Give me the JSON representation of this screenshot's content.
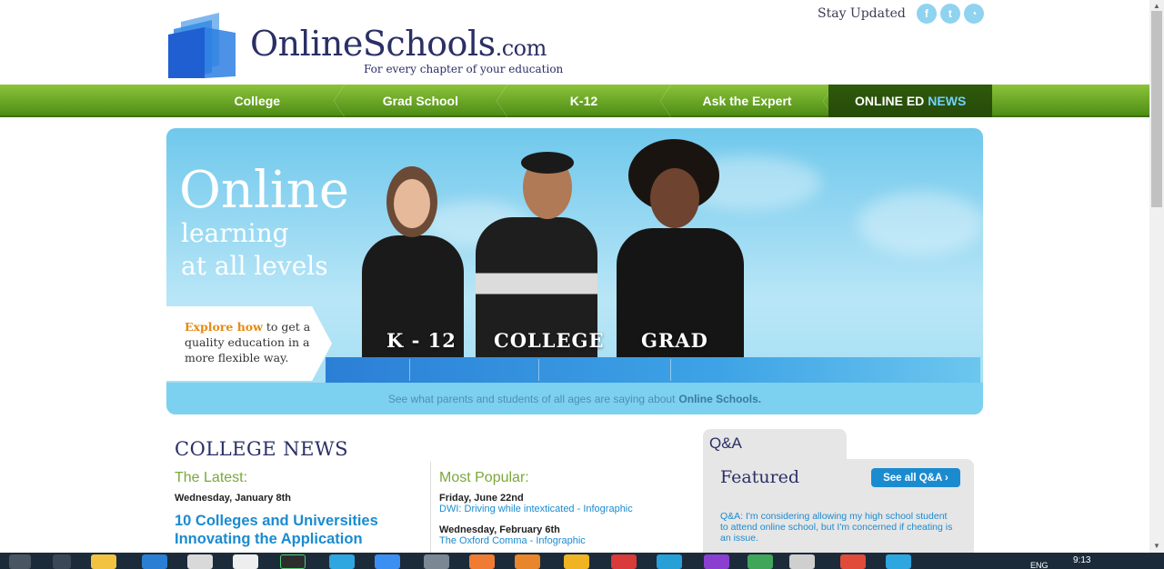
{
  "header": {
    "logo_main": "OnlineSchools",
    "logo_suffix": ".com",
    "tagline": "For every chapter of your education",
    "stay_updated": "Stay Updated",
    "social": [
      {
        "name": "facebook-icon",
        "glyph": "f"
      },
      {
        "name": "twitter-icon",
        "glyph": "t"
      },
      {
        "name": "rss-icon",
        "glyph": "◔"
      }
    ]
  },
  "nav": {
    "items": [
      "College",
      "Grad School",
      "K-12",
      "Ask the Expert"
    ],
    "active_prefix": "ONLINE ED",
    "active_suffix": "NEWS"
  },
  "hero": {
    "title": "Online",
    "subtitle_line1": "learning",
    "subtitle_line2": "at all levels",
    "explore_highlight": "Explore how",
    "explore_rest": "to get a quality education in a more flexible way.",
    "levels": [
      "K - 12",
      "COLLEGE",
      "GRAD"
    ],
    "footer_text": "See what parents and students of all ages are saying about",
    "footer_bold": "Online Schools."
  },
  "college_news": {
    "title": "COLLEGE NEWS",
    "latest_heading": "The Latest:",
    "latest_date": "Wednesday, January 8th",
    "latest_title": "10 Colleges and Universities Innovating the Application",
    "popular_heading": "Most Popular:",
    "popular": [
      {
        "date": "Friday, June 22nd",
        "title": "DWI: Driving while intexticated - Infographic"
      },
      {
        "date": "Wednesday, February 6th",
        "title": "The Oxford Comma - Infographic"
      }
    ]
  },
  "qa": {
    "tab": "Q&A",
    "featured": "Featured",
    "see_all": "See all Q&A ›",
    "text": "Q&A: I'm considering allowing my high school student to attend online school, but I'm concerned if cheating is an issue."
  },
  "taskbar": {
    "time": "9:13",
    "lang": "ENG"
  }
}
